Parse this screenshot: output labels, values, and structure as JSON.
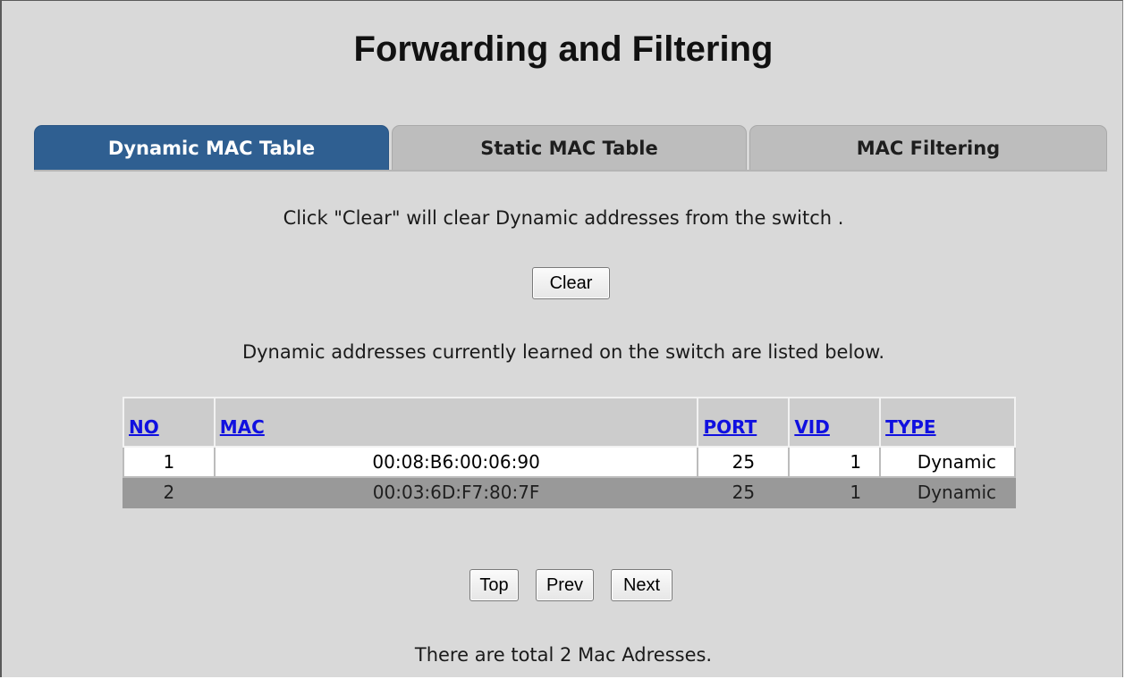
{
  "page": {
    "title": "Forwarding and Filtering"
  },
  "tabs": [
    {
      "label": "Dynamic MAC Table",
      "active": true
    },
    {
      "label": "Static MAC Table",
      "active": false
    },
    {
      "label": "MAC Filtering",
      "active": false
    }
  ],
  "clear_section": {
    "instruction": "Click \"Clear\" will clear Dynamic addresses from the switch .",
    "clear_label": "Clear"
  },
  "list_description": "Dynamic addresses currently learned on the switch are listed below.",
  "table": {
    "columns": [
      "NO",
      "MAC",
      "PORT",
      "VID",
      "TYPE"
    ],
    "rows": [
      {
        "no": "1",
        "mac": "00:08:B6:00:06:90",
        "port": "25",
        "vid": "1",
        "type": "Dynamic"
      },
      {
        "no": "2",
        "mac": "00:03:6D:F7:80:7F",
        "port": "25",
        "vid": "1",
        "type": "Dynamic"
      }
    ]
  },
  "pagination": {
    "top_label": "Top",
    "prev_label": "Prev",
    "next_label": "Next"
  },
  "summary": "There are total 2 Mac Adresses.",
  "colors": {
    "active_tab": "#2f5f91",
    "inactive_tab": "#bdbdbd",
    "header_link": "#1010e0",
    "page_background": "#d9d9d9"
  }
}
